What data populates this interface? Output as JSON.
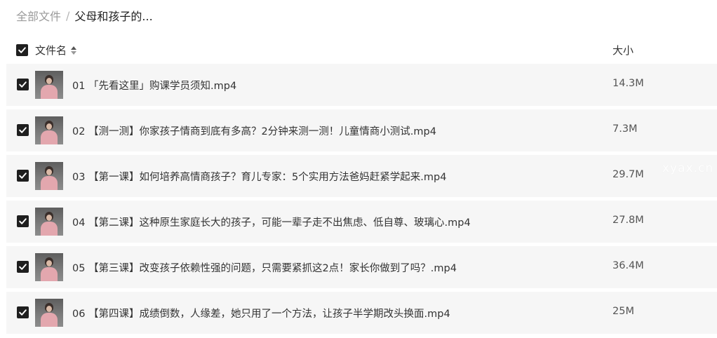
{
  "breadcrumb": {
    "root": "全部文件",
    "separator": "/",
    "current": "父母和孩子的..."
  },
  "header": {
    "name_label": "文件名",
    "size_label": "大小",
    "select_all_checked": true
  },
  "files": [
    {
      "name": "01 「先看这里」购课学员须知.mp4",
      "size": "14.3M",
      "checked": true
    },
    {
      "name": "02 【测一测】你家孩子情商到底有多高？2分钟来测一测！儿童情商小测试.mp4",
      "size": "7.3M",
      "checked": true
    },
    {
      "name": "03 【第一课】如何培养高情商孩子？育儿专家：5个实用方法爸妈赶紧学起来.mp4",
      "size": "29.7M",
      "checked": true
    },
    {
      "name": "04 【第二课】这种原生家庭长大的孩子，可能一辈子走不出焦虑、低自尊、玻璃心.mp4",
      "size": "27.8M",
      "checked": true
    },
    {
      "name": "05 【第三课】改变孩子依赖性强的问题，只需要紧抓这2点！家长你做到了吗？.mp4",
      "size": "36.4M",
      "checked": true
    },
    {
      "name": "06 【第四课】成绩倒数，人缘差，她只用了一个方法，让孩子半学期改头换面.mp4",
      "size": "25M",
      "checked": true
    }
  ],
  "watermark": "xyax.cn",
  "icons": {
    "checkbox": "checkmark-icon",
    "sort": "sort-icon",
    "thumbnail": "video-thumbnail"
  },
  "colors": {
    "checkbox": "#1f1f1f",
    "row_bg": "#f6f6f6",
    "muted_text": "#9a9a9a"
  }
}
